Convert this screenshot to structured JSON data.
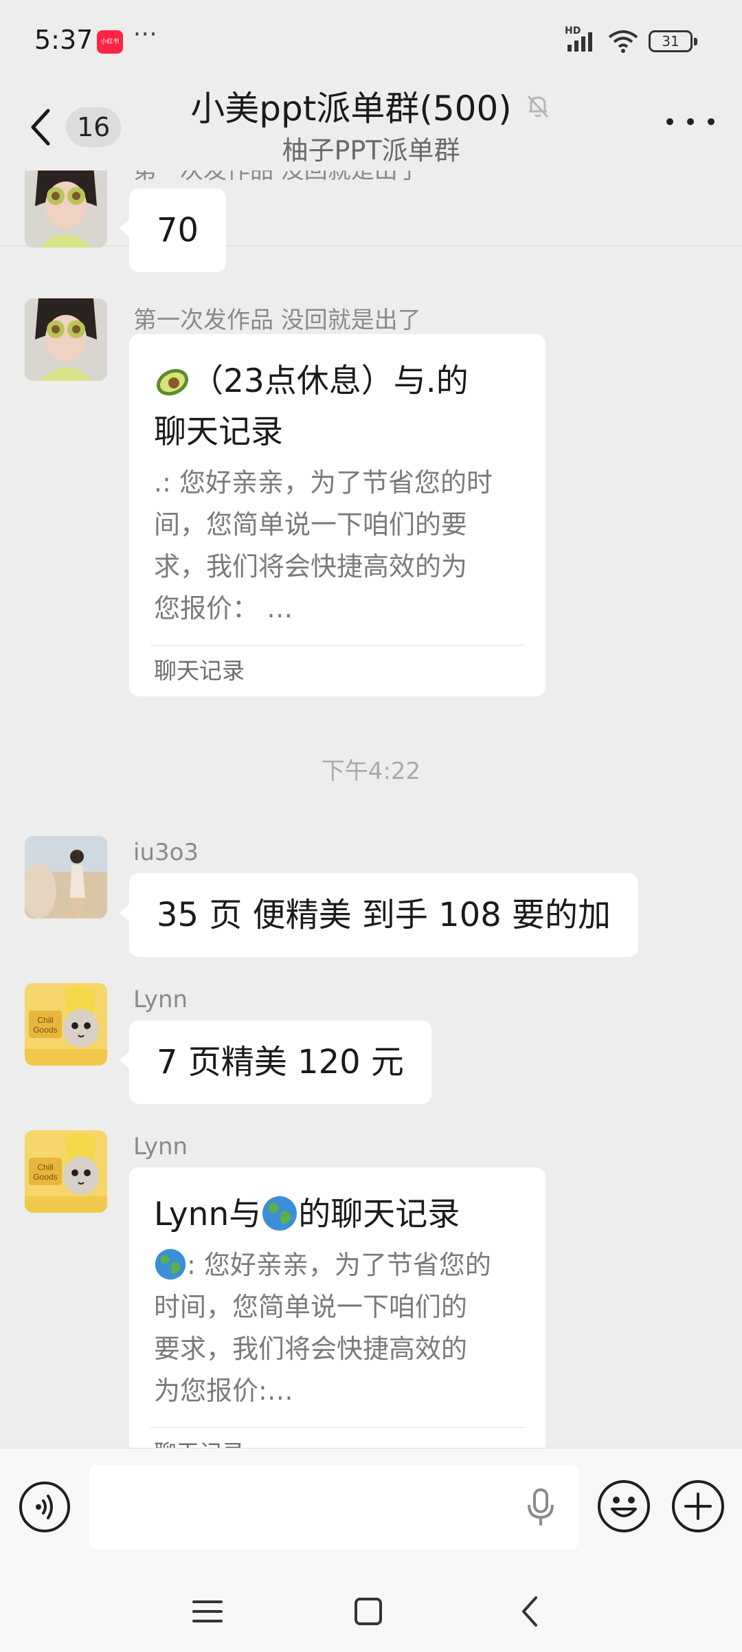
{
  "status_bar": {
    "time": "5:37",
    "app_icon_label": "小红书",
    "more": "···",
    "network": "HD",
    "battery": "31"
  },
  "header": {
    "back_count": "16",
    "title": "小美ppt派单群(500)",
    "subtitle": "柚子PPT派单群",
    "icons": [
      "chevron-left-icon",
      "mute-bell-icon",
      "more-dots-icon"
    ]
  },
  "messages": [
    {
      "sender": "第一次发作品  没回就是出了",
      "text": "70"
    },
    {
      "sender": "第一次发作品  没回就是出了",
      "record_title_lines": [
        "（23点休息）与.的",
        "聊天记录"
      ],
      "record_body_lines": [
        ".: 您好亲亲，为了节省您的时",
        "间，您简单说一下咱们的要",
        "求，我们将会快捷高效的为",
        "您报价：  …"
      ],
      "record_footer": "聊天记录"
    },
    {
      "timestamp": "下午4:22"
    },
    {
      "sender": "iu3o3",
      "text": "35 页  便精美   到手 108  要的加"
    },
    {
      "sender": "Lynn",
      "text": "7 页精美 120 元"
    },
    {
      "sender": "Lynn",
      "record_title_parts": [
        "Lynn与",
        "的聊天记录"
      ],
      "record_body_lines": [
        ": 您好亲亲，为了节省您的",
        "时间，您简单说一下咱们的",
        "要求，我们将会快捷高效的",
        "为您报价:…"
      ],
      "record_footer": "聊天记录"
    }
  ],
  "input_bar": {
    "placeholder": "",
    "icons": [
      "voice-icon",
      "microphone-icon",
      "emoji-icon",
      "plus-icon"
    ]
  },
  "nav_bar": {
    "icons": [
      "menu-icon",
      "home-square-icon",
      "back-triangle-icon"
    ]
  },
  "colors": {
    "background": "#EDEDED",
    "bubble": "#FFFFFF",
    "secondary_text": "#8A8A8A"
  }
}
